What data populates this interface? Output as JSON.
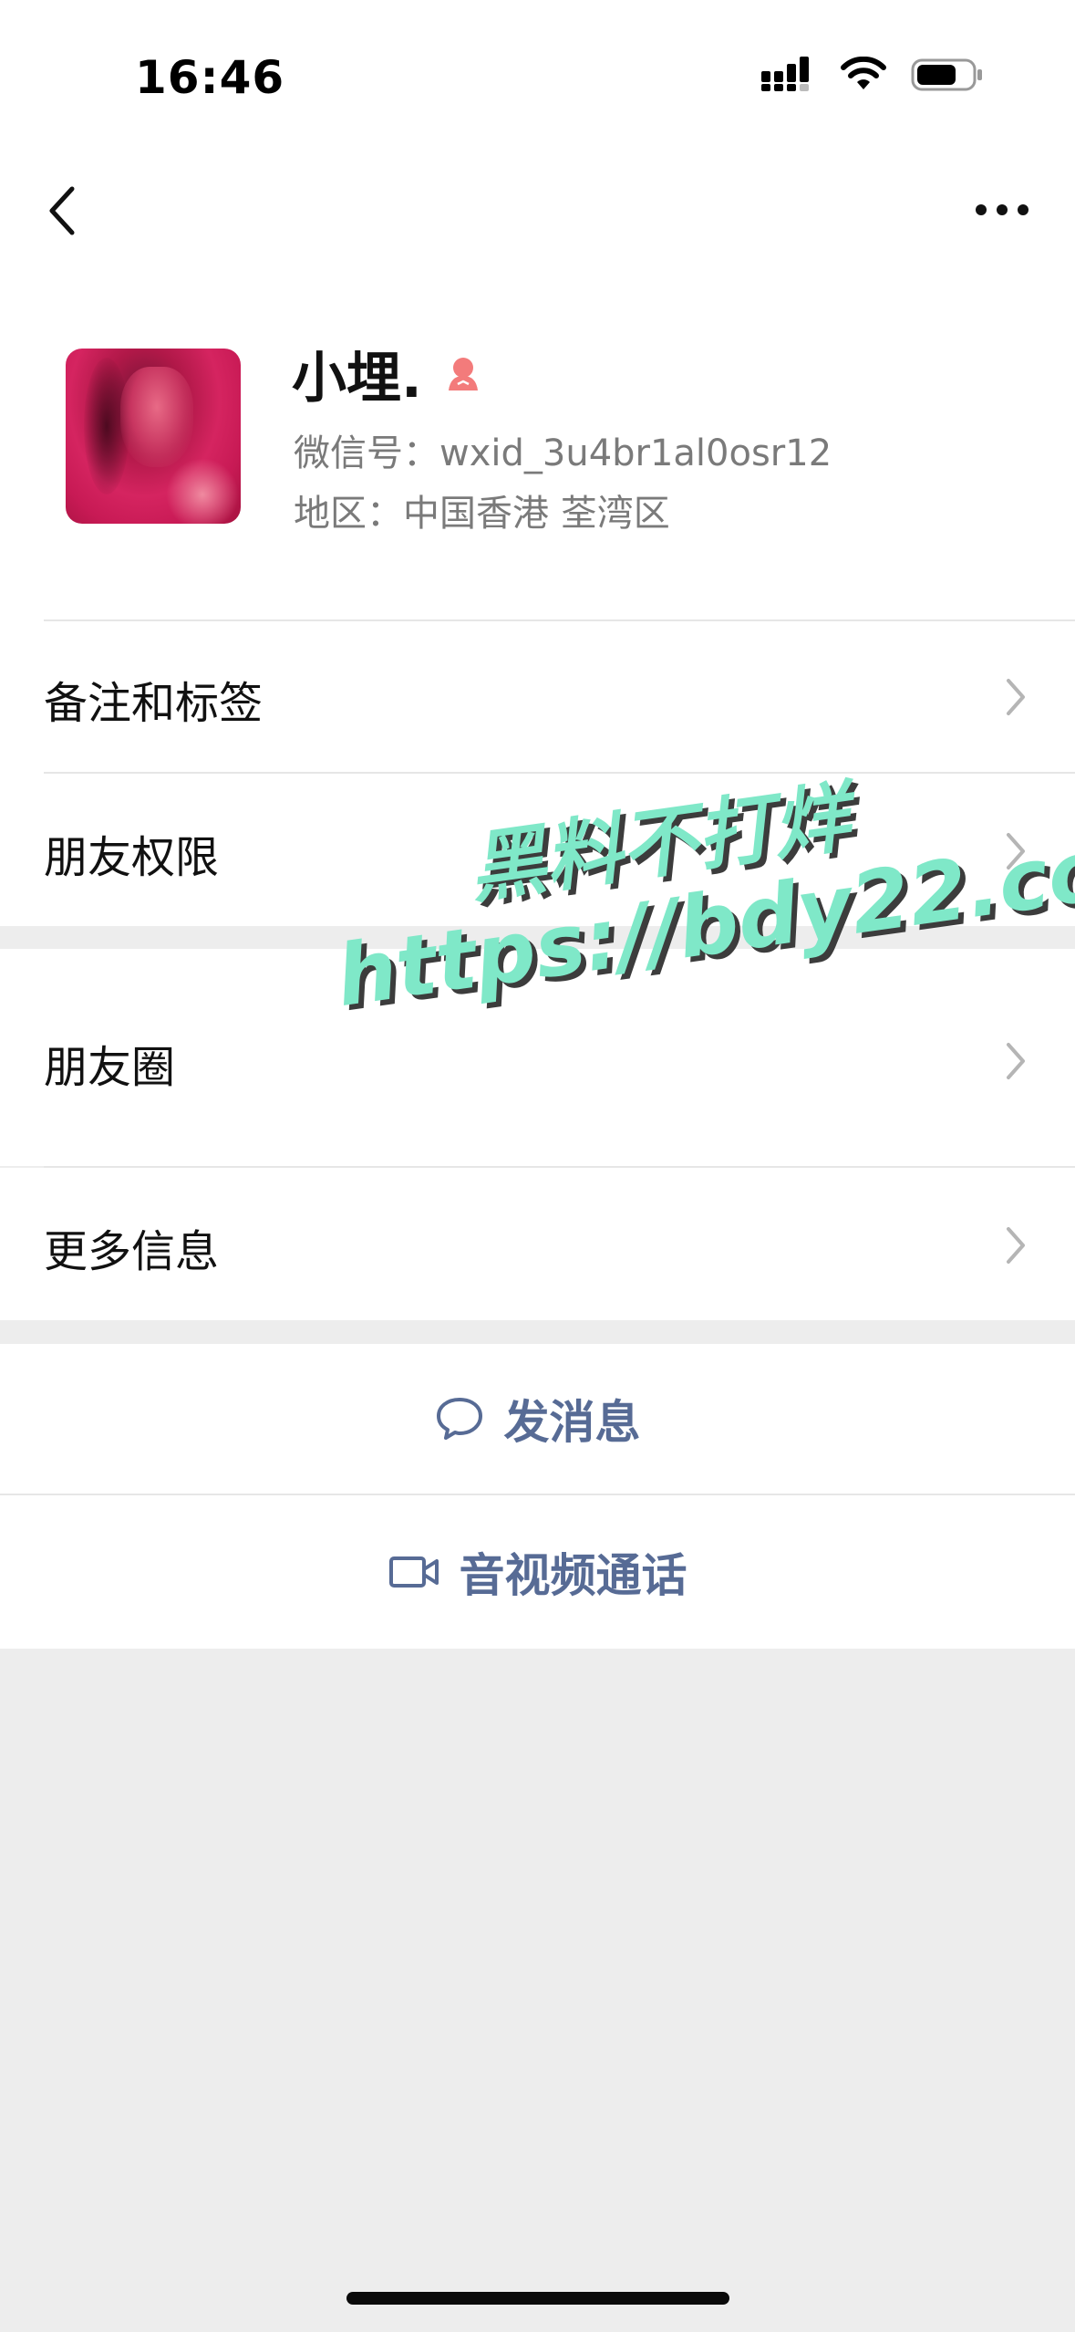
{
  "status_bar": {
    "time": "16:46"
  },
  "nav": {
    "back_icon": "chevron-left-icon",
    "more_icon": "ellipsis-icon"
  },
  "profile": {
    "name": "小埋.",
    "gender_icon": "female-icon",
    "gender_color": "#f37b7b",
    "wxid_line": "微信号：wxid_3u4br1al0osr12",
    "region_line": "地区：中国香港 荃湾区"
  },
  "rows": {
    "remarks": "备注和标签",
    "permissions": "朋友权限",
    "moments": "朋友圈",
    "more_info": "更多信息"
  },
  "actions": {
    "send_message": "发消息",
    "call": "音视频通话",
    "accent_color": "#576b95"
  },
  "watermark": {
    "line1": "黑料不打烊",
    "line2": "https://bdy22.co"
  }
}
